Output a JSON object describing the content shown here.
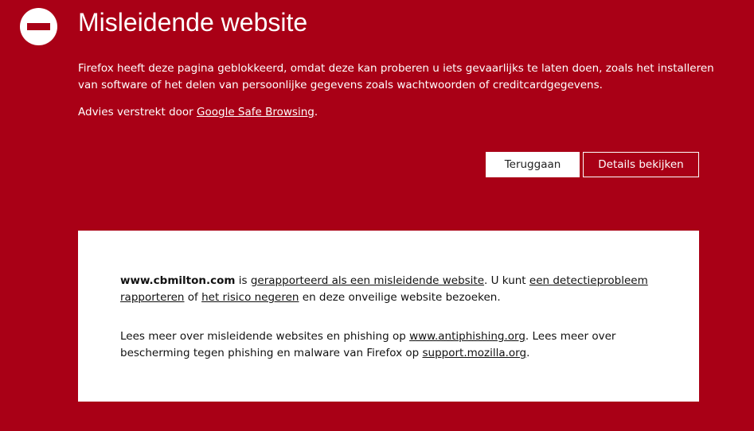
{
  "header": {
    "title": "Misleidende website",
    "icon": "block-icon"
  },
  "description": "Firefox heeft deze pagina geblokkeerd, omdat deze kan proberen u iets gevaarlijks te laten doen, zoals het installeren van software of het delen van persoonlijke gegevens zoals wachtwoorden of creditcardgegevens.",
  "advice": {
    "prefix": "Advies verstrekt door ",
    "link": "Google Safe Browsing",
    "suffix": "."
  },
  "buttons": {
    "back": "Teruggaan",
    "details": "Details bekijken"
  },
  "details": {
    "site": "www.cbmilton.com",
    "is_text": " is ",
    "reported_link": "gerapporteerd als een misleidende website",
    "mid_text": ". U kunt ",
    "report_link": "een detectieprobleem rapporteren",
    "or_text": " of ",
    "ignore_link": "het risico negeren",
    "end_text": " en deze onveilige website bezoeken.",
    "learn_prefix": "Lees meer over misleidende websites en phishing op ",
    "antiphishing_link": "www.antiphishing.org",
    "learn_mid": ". Lees meer over bescherming tegen phishing en malware van Firefox op ",
    "support_link": "support.mozilla.org",
    "learn_suffix": "."
  },
  "colors": {
    "background": "#a90016",
    "card": "#ffffff",
    "text_on_red": "#ffffff"
  }
}
